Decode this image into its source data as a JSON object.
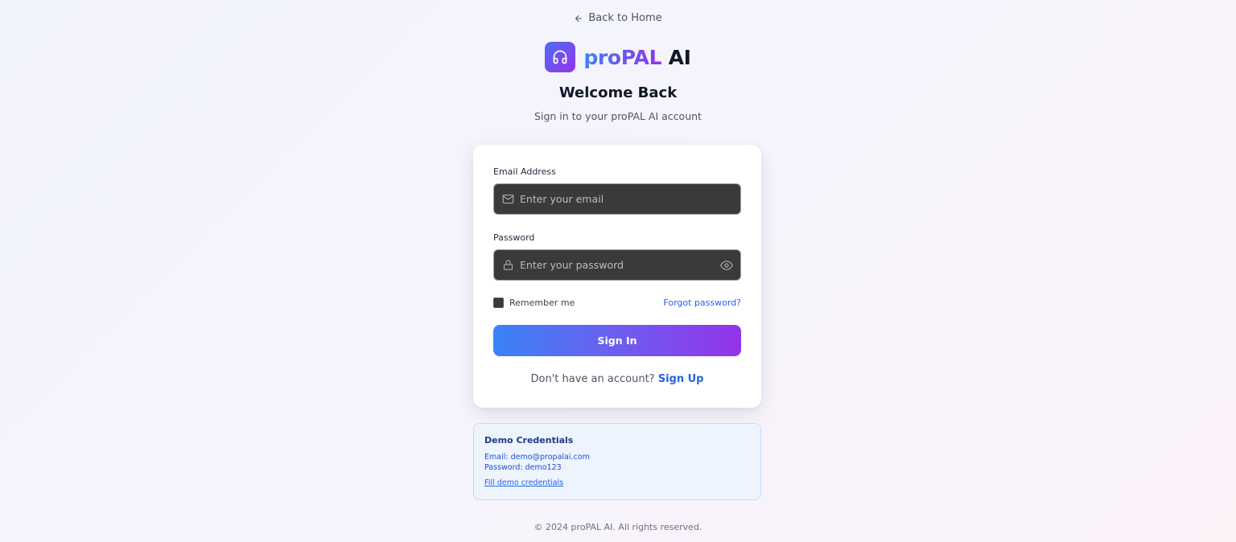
{
  "nav": {
    "back_label": "Back to Home"
  },
  "brand": {
    "name_part1": "proPAL",
    "name_part2": "AI",
    "logo_icon": "headphones-icon"
  },
  "header": {
    "title": "Welcome Back",
    "subtitle": "Sign in to your proPAL AI account"
  },
  "form": {
    "email_label": "Email Address",
    "email_placeholder": "Enter your email",
    "email_value": "",
    "password_label": "Password",
    "password_placeholder": "Enter your password",
    "password_value": "",
    "remember_label": "Remember me",
    "remember_checked": false,
    "forgot_label": "Forgot password?",
    "submit_label": "Sign In",
    "signup_prompt": "Don't have an account?",
    "signup_link": "Sign Up"
  },
  "demo": {
    "title": "Demo Credentials",
    "email_line": "Email: demo@propalai.com",
    "password_line": "Password: demo123",
    "fill_link": "Fill demo credentials"
  },
  "footer": {
    "copyright": "© 2024 proPAL AI. All rights reserved."
  },
  "colors": {
    "accent_start": "#3b82f6",
    "accent_end": "#9333ea",
    "link": "#2563eb",
    "input_bg": "#3a3a3a"
  }
}
